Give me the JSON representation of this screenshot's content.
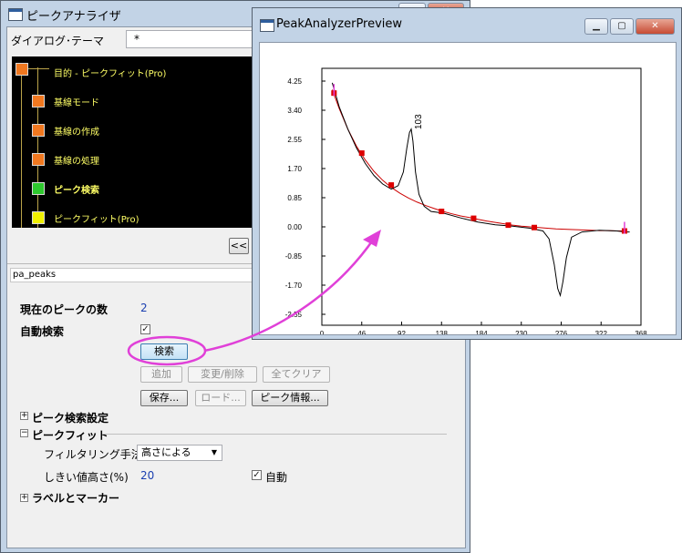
{
  "main_window": {
    "title": "ピークアナライザ",
    "theme_label": "ダイアログ･テーマ",
    "theme_value": "*",
    "flow_steps": [
      {
        "label": "目的 - ピークフィット(Pro)",
        "color": "#f07820"
      },
      {
        "label": "基線モード",
        "color": "#f07820"
      },
      {
        "label": "基線の作成",
        "color": "#f07820"
      },
      {
        "label": "基線の処理",
        "color": "#f07820"
      },
      {
        "label": "ピーク検索",
        "color": "#2ec82e"
      },
      {
        "label": "ピークフィット(Pro)",
        "color": "#f0f000"
      }
    ],
    "nav_button": "<<",
    "page_name": "pa_peaks",
    "peak_count_label": "現在のピークの数",
    "peak_count_value": "2",
    "auto_find_label": "自動検索",
    "auto_find_checked": true,
    "buttons": {
      "find": "検索",
      "add": "追加",
      "modify": "変更/削除",
      "clear_all": "全てクリア",
      "save": "保存...",
      "load": "ロード...",
      "peak_info": "ピーク情報..."
    },
    "sections": {
      "peak_find_settings": "ピーク検索設定",
      "peak_filter": "ピークフィット",
      "labels_markers": "ラベルとマーカー"
    },
    "filter_method_label": "フィルタリング手法",
    "filter_method_value": "高さによる",
    "threshold_label": "しきい値高さ(%)",
    "threshold_value": "20",
    "auto_label": "自動",
    "auto_checked": true
  },
  "preview_window": {
    "title": "PeakAnalyzerPreview",
    "peak_label": "103"
  },
  "colors": {
    "highlight": "#e040d8",
    "baseline": "#cc0000",
    "anchor": "#dd0000"
  },
  "chart_data": {
    "type": "line",
    "xlim": [
      0,
      368
    ],
    "ylim": [
      -2.55,
      4.25
    ],
    "x_ticks": [
      "0",
      "46",
      "92",
      "138",
      "184",
      "230",
      "276",
      "322",
      "368"
    ],
    "y_ticks": [
      "4.25",
      "3.40",
      "2.55",
      "1.70",
      "0.85",
      "0.00",
      "-0.85",
      "-1.70",
      "-2.55"
    ],
    "series": [
      {
        "role": "data",
        "x": [
          12,
          20,
          30,
          40,
          50,
          60,
          70,
          80,
          88,
          94,
          98,
          101,
          103,
          105,
          108,
          112,
          118,
          126,
          140,
          160,
          180,
          200,
          220,
          240,
          255,
          262,
          268,
          272,
          275,
          278,
          282,
          288,
          300,
          320,
          340,
          350,
          355
        ],
        "y": [
          4.2,
          3.5,
          2.85,
          2.3,
          1.85,
          1.5,
          1.25,
          1.1,
          1.2,
          1.6,
          2.3,
          2.75,
          2.85,
          2.5,
          1.6,
          0.95,
          0.6,
          0.45,
          0.4,
          0.26,
          0.14,
          0.06,
          0.02,
          -0.04,
          -0.12,
          -0.35,
          -1.1,
          -1.8,
          -2.0,
          -1.6,
          -0.9,
          -0.3,
          -0.15,
          -0.1,
          -0.12,
          -0.15,
          -0.15
        ]
      },
      {
        "role": "baseline",
        "x": [
          12,
          20,
          30,
          40,
          50,
          60,
          70,
          80,
          90,
          100,
          110,
          120,
          130,
          140,
          150,
          160,
          170,
          180,
          190,
          200,
          210,
          220,
          230,
          240,
          250,
          260,
          270,
          280,
          290,
          300,
          310,
          320,
          330,
          340,
          350
        ],
        "y": [
          4.0,
          3.45,
          2.85,
          2.35,
          1.95,
          1.62,
          1.36,
          1.15,
          0.98,
          0.84,
          0.72,
          0.62,
          0.53,
          0.45,
          0.38,
          0.32,
          0.27,
          0.22,
          0.17,
          0.13,
          0.09,
          0.05,
          0.02,
          0.0,
          -0.02,
          -0.04,
          -0.06,
          -0.07,
          -0.08,
          -0.09,
          -0.1,
          -0.11,
          -0.11,
          -0.12,
          -0.12
        ]
      }
    ],
    "anchor_points": {
      "x": [
        14,
        46,
        80,
        138,
        175,
        215,
        245,
        349
      ],
      "y": [
        3.9,
        2.15,
        1.22,
        0.45,
        0.25,
        0.05,
        -0.02,
        -0.12
      ]
    }
  }
}
